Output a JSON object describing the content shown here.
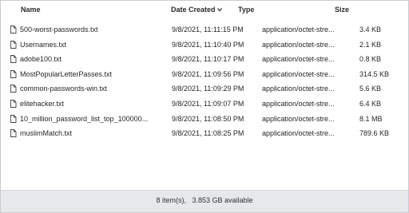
{
  "columns": {
    "name": "Name",
    "date": "Date Created",
    "type": "Type",
    "size": "Size",
    "sort_icon": "chevron-down-icon"
  },
  "files": [
    {
      "name": "500-worst-passwords.txt",
      "date": "9/8/2021, 11:11:15 PM",
      "type": "application/octet-stre...",
      "size": "3.4 KB"
    },
    {
      "name": "Usernames.txt",
      "date": "9/8/2021, 11:10:40 PM",
      "type": "application/octet-stre...",
      "size": "2.1 KB"
    },
    {
      "name": "adobe100.txt",
      "date": "9/8/2021, 11:10:17 PM",
      "type": "application/octet-stre...",
      "size": "0.8 KB"
    },
    {
      "name": "MostPopularLetterPasses.txt",
      "date": "9/8/2021, 11:09:56 PM",
      "type": "application/octet-stre...",
      "size": "314.5 KB"
    },
    {
      "name": "common-passwords-win.txt",
      "date": "9/8/2021, 11:09:29 PM",
      "type": "application/octet-stre...",
      "size": "5.6 KB"
    },
    {
      "name": "elitehacker.txt",
      "date": "9/8/2021, 11:09:07 PM",
      "type": "application/octet-stre...",
      "size": "6.4 KB"
    },
    {
      "name": "10_million_password_list_top_100000...",
      "date": "9/8/2021, 11:08:50 PM",
      "type": "application/octet-stre...",
      "size": "8.1 MB"
    },
    {
      "name": "muslimMatch.txt",
      "date": "9/8/2021, 11:08:25 PM",
      "type": "application/octet-stre...",
      "size": "789.6 KB"
    }
  ],
  "file_icon": "file-icon",
  "status": {
    "text": "8 item(s),   3.853 GB available"
  }
}
